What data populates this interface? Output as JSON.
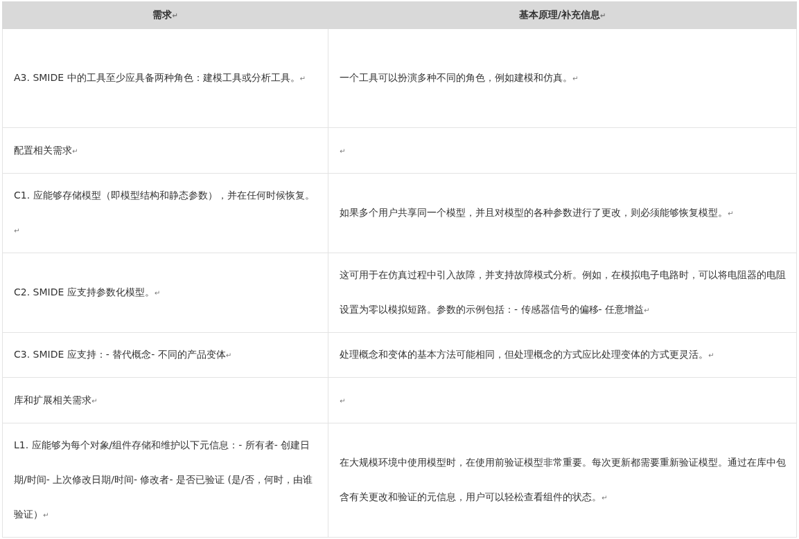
{
  "table": {
    "columns": [
      {
        "label": "需求",
        "mark": "↵"
      },
      {
        "label": "基本原理/补充信息",
        "mark": "↵"
      }
    ],
    "rows": [
      {
        "cells": [
          {
            "text": "A3. SMIDE 中的工具至少应具备两种角色：建模工具或分析工具。",
            "mark": "↵"
          },
          {
            "text": "一个工具可以扮演多种不同的角色，例如建模和仿真。",
            "mark": "↵"
          }
        ]
      },
      {
        "cells": [
          {
            "text": "配置相关需求",
            "mark": "↵"
          },
          {
            "mark": "↵"
          }
        ]
      },
      {
        "cells": [
          {
            "text": "C1.  应能够存储模型（即模型结构和静态参数），并在任何时候恢复。",
            "mark": "↵"
          },
          {
            "text": "如果多个用户共享同一个模型，并且对模型的各种参数进行了更改，则必须能够恢复模型。",
            "mark": "↵"
          }
        ]
      },
      {
        "cells": [
          {
            "text": "C2. SMIDE 应支持参数化模型。",
            "mark": "↵"
          },
          {
            "text": "这可用于在仿真过程中引入故障，并支持故障模式分析。例如，在模拟电子电路时，可以将电阻器的电阻设置为零以模拟短路。参数的示例包括：-  传感器信号的偏移-  任意增益",
            "mark": "↵"
          }
        ]
      },
      {
        "cells": [
          {
            "text": "C3. SMIDE 应支持：-  替代概念-  不同的产品变体",
            "mark": "↵"
          },
          {
            "text": "处理概念和变体的基本方法可能相同，但处理概念的方式应比处理变体的方式更灵活。",
            "mark": "↵"
          }
        ]
      },
      {
        "cells": [
          {
            "text": "库和扩展相关需求",
            "mark": "↵"
          },
          {
            "mark": "↵"
          }
        ]
      },
      {
        "cells": [
          {
            "text": "L1.  应能够为每个对象/组件存储和维护以下元信息：-  所有者-  创建日期/时间-  上次修改日期/时间-  修改者-  是否已验证 (是/否，何时，由谁验证）",
            "mark": "↵"
          },
          {
            "text": "在大规模环境中使用模型时，在使用前验证模型非常重要。每次更新都需要重新验证模型。通过在库中包含有关更改和验证的元信息，用户可以轻松查看组件的状态。",
            "mark": "↵"
          }
        ]
      }
    ]
  }
}
